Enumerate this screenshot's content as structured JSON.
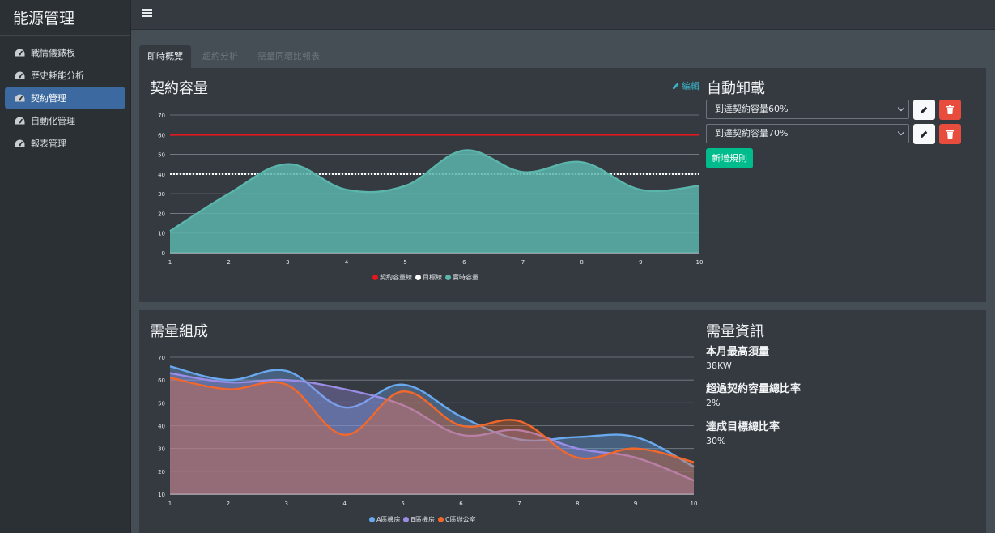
{
  "sidebar": {
    "brand": "能源管理",
    "items": [
      {
        "label": "戰情儀錶板",
        "active": false
      },
      {
        "label": "歷史耗能分析",
        "active": false
      },
      {
        "label": "契約管理",
        "active": true
      },
      {
        "label": "自動化管理",
        "active": false
      },
      {
        "label": "報表管理",
        "active": false
      }
    ]
  },
  "tabs": [
    {
      "label": "即時概覽",
      "active": true
    },
    {
      "label": "超約分析",
      "active": false
    },
    {
      "label": "需量同環比報表",
      "active": false
    }
  ],
  "contract": {
    "title": "契約容量",
    "edit_label": "編輯"
  },
  "unload": {
    "title": "自動卸載",
    "rules": [
      {
        "value": "到達契約容量60%"
      },
      {
        "value": "到達契約容量70%"
      }
    ],
    "add_label": "新增規則"
  },
  "demand": {
    "title": "需量組成"
  },
  "info": {
    "title": "需量資訊",
    "items": [
      {
        "label": "本月最高須量",
        "value": "38KW"
      },
      {
        "label": "超過契約容量總比率",
        "value": "2%"
      },
      {
        "label": "達成目標總比率",
        "value": "30%"
      }
    ]
  },
  "colors": {
    "contract_line": "#e0191f",
    "target_line": "#ffffff",
    "actual": "#5bb5ac",
    "series_a": "#6aa9f0",
    "series_b": "#9b8ce6",
    "series_c": "#f2682b"
  },
  "chart_data": [
    {
      "type": "area",
      "x": [
        1,
        2,
        3,
        4,
        5,
        6,
        7,
        8,
        9,
        10
      ],
      "ylim": [
        0,
        70
      ],
      "yticks": [
        0,
        10,
        20,
        30,
        40,
        50,
        60,
        70
      ],
      "legend_position": "bottom",
      "grid": true,
      "series": [
        {
          "name": "契約容量線",
          "values": [
            60,
            60,
            60,
            60,
            60,
            60,
            60,
            60,
            60,
            60
          ],
          "style": "line"
        },
        {
          "name": "目標線",
          "values": [
            40,
            40,
            40,
            40,
            40,
            40,
            40,
            40,
            40,
            40
          ],
          "style": "dotted"
        },
        {
          "name": "實時容量",
          "values": [
            11,
            30,
            45,
            32,
            34,
            52,
            41,
            46,
            32,
            34
          ],
          "style": "area"
        }
      ]
    },
    {
      "type": "area",
      "x": [
        1,
        2,
        3,
        4,
        5,
        6,
        7,
        8,
        9,
        10
      ],
      "ylim": [
        10,
        70
      ],
      "yticks": [
        10,
        20,
        30,
        40,
        50,
        60,
        70
      ],
      "legend_position": "bottom",
      "grid": true,
      "series": [
        {
          "name": "A區機房",
          "values": [
            66,
            60,
            64,
            48,
            58,
            44,
            34,
            35,
            35,
            22
          ]
        },
        {
          "name": "B區機房",
          "values": [
            63,
            59,
            60,
            56,
            49,
            36,
            38,
            30,
            26,
            16
          ]
        },
        {
          "name": "C區辦公室",
          "values": [
            61,
            56,
            58,
            36,
            55,
            40,
            42,
            26,
            30,
            24
          ]
        }
      ]
    }
  ]
}
